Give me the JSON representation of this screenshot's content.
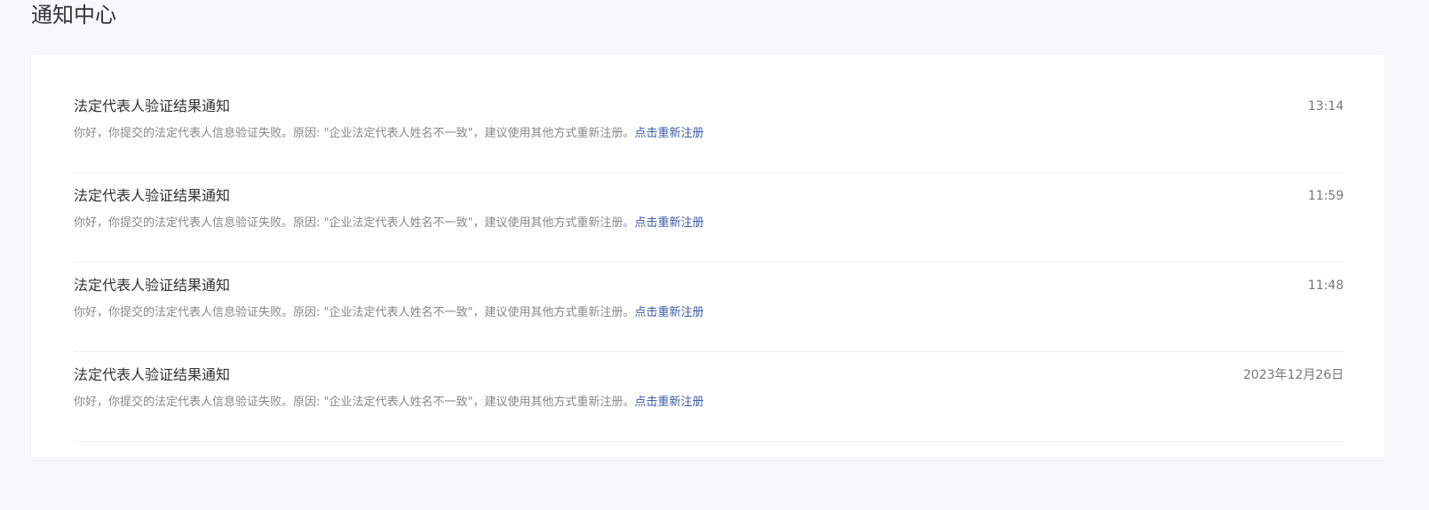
{
  "page": {
    "title": "通知中心"
  },
  "colors": {
    "background": "#f7f8fa",
    "card": "#ffffff",
    "title_text": "#333333",
    "body_text": "#888888",
    "link": "#3b5aa8",
    "divider": "#eeeeee"
  },
  "notifications": [
    {
      "title": "法定代表人验证结果通知",
      "time": "13:14",
      "body": "你好，你提交的法定代表人信息验证失败。原因: \"企业法定代表人姓名不一致\"，建议使用其他方式重新注册。",
      "link_label": "点击重新注册"
    },
    {
      "title": "法定代表人验证结果通知",
      "time": "11:59",
      "body": "你好，你提交的法定代表人信息验证失败。原因: \"企业法定代表人姓名不一致\"，建议使用其他方式重新注册。",
      "link_label": "点击重新注册"
    },
    {
      "title": "法定代表人验证结果通知",
      "time": "11:48",
      "body": "你好，你提交的法定代表人信息验证失败。原因: \"企业法定代表人姓名不一致\"，建议使用其他方式重新注册。",
      "link_label": "点击重新注册"
    },
    {
      "title": "法定代表人验证结果通知",
      "time": "2023年12月26日",
      "body": "你好，你提交的法定代表人信息验证失败。原因: \"企业法定代表人姓名不一致\"，建议使用其他方式重新注册。",
      "link_label": "点击重新注册"
    }
  ]
}
